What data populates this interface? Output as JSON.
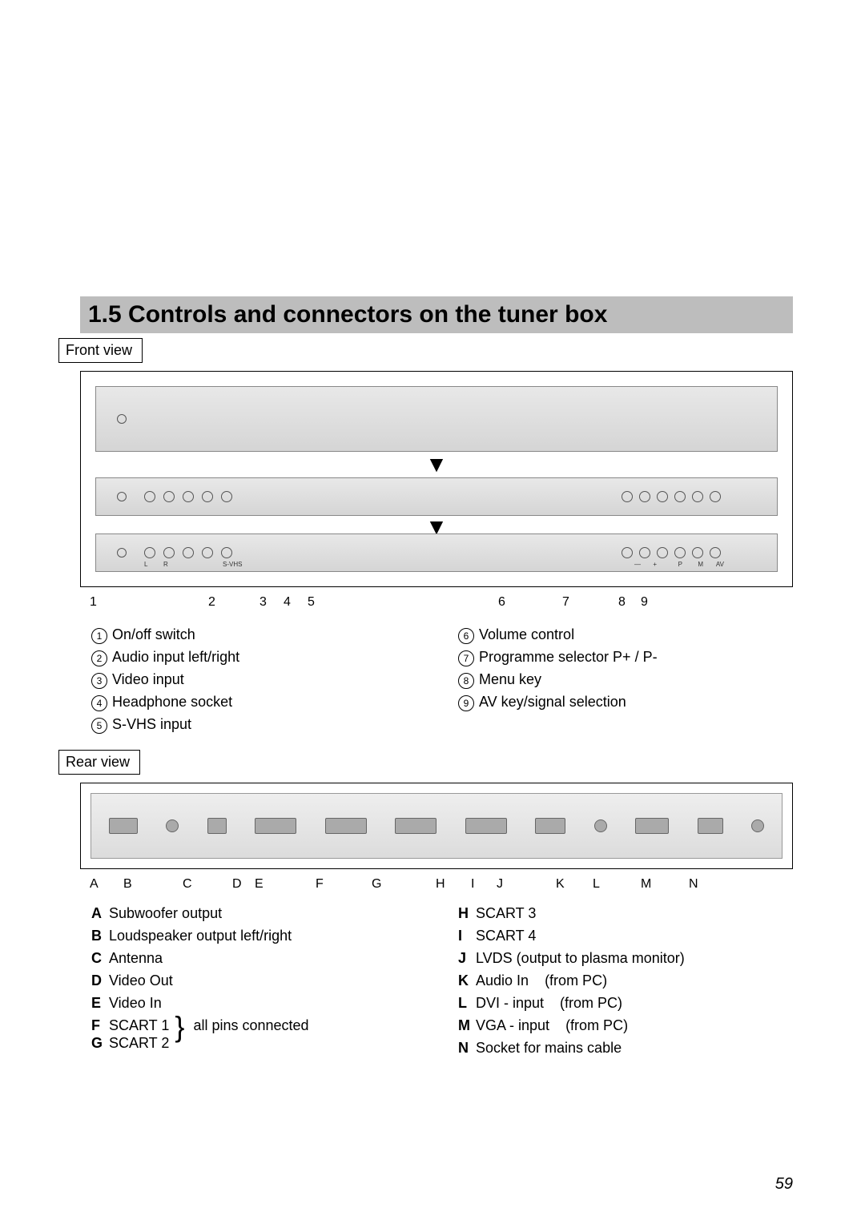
{
  "page_number": "59",
  "heading": "1.5 Controls and connectors on the tuner box",
  "front_view_label": "Front view",
  "rear_view_label": "Rear view",
  "front_callouts": [
    "1",
    "2",
    "3",
    "4",
    "5",
    "6",
    "7",
    "8",
    "9"
  ],
  "front_legend_left": [
    {
      "n": "1",
      "t": "On/off switch"
    },
    {
      "n": "2",
      "t": "Audio input left/right"
    },
    {
      "n": "3",
      "t": "Video input"
    },
    {
      "n": "4",
      "t": "Headphone socket"
    },
    {
      "n": "5",
      "t": "S-VHS input"
    }
  ],
  "front_legend_right": [
    {
      "n": "6",
      "t": "Volume control"
    },
    {
      "n": "7",
      "t": "Programme selector P+ / P-"
    },
    {
      "n": "8",
      "t": "Menu key"
    },
    {
      "n": "9",
      "t": "AV key/signal selection"
    }
  ],
  "rear_callouts": [
    "A",
    "B",
    "C",
    "D",
    "E",
    "F",
    "G",
    "H",
    "I",
    "J",
    "K",
    "L",
    "M",
    "N"
  ],
  "rear_legend_left": [
    {
      "k": "A",
      "t": "Subwoofer output"
    },
    {
      "k": "B",
      "t": "Loudspeaker output left/right"
    },
    {
      "k": "C",
      "t": "Antenna"
    },
    {
      "k": "D",
      "t": "Video Out"
    },
    {
      "k": "E",
      "t": "Video In"
    },
    {
      "k": "F",
      "t": "SCART 1"
    },
    {
      "k": "G",
      "t": "SCART 2"
    }
  ],
  "rear_fg_note": "all pins connected",
  "rear_legend_right": [
    {
      "k": "H",
      "t": "SCART 3",
      "extra": ""
    },
    {
      "k": "I",
      "t": "SCART 4",
      "extra": ""
    },
    {
      "k": "J",
      "t": "LVDS (output to plasma monitor)",
      "extra": ""
    },
    {
      "k": "K",
      "t": "Audio In",
      "extra": "(from PC)"
    },
    {
      "k": "L",
      "t": "DVI - input",
      "extra": "(from PC)"
    },
    {
      "k": "M",
      "t": "VGA - input",
      "extra": "(from PC)"
    },
    {
      "k": "N",
      "t": "Socket for mains cable",
      "extra": ""
    }
  ],
  "panel_labels": {
    "L": "L",
    "R": "R",
    "svhs": "S-VHS",
    "minus": "—",
    "plus": "+",
    "P": "P",
    "M": "M",
    "AV": "AV"
  }
}
